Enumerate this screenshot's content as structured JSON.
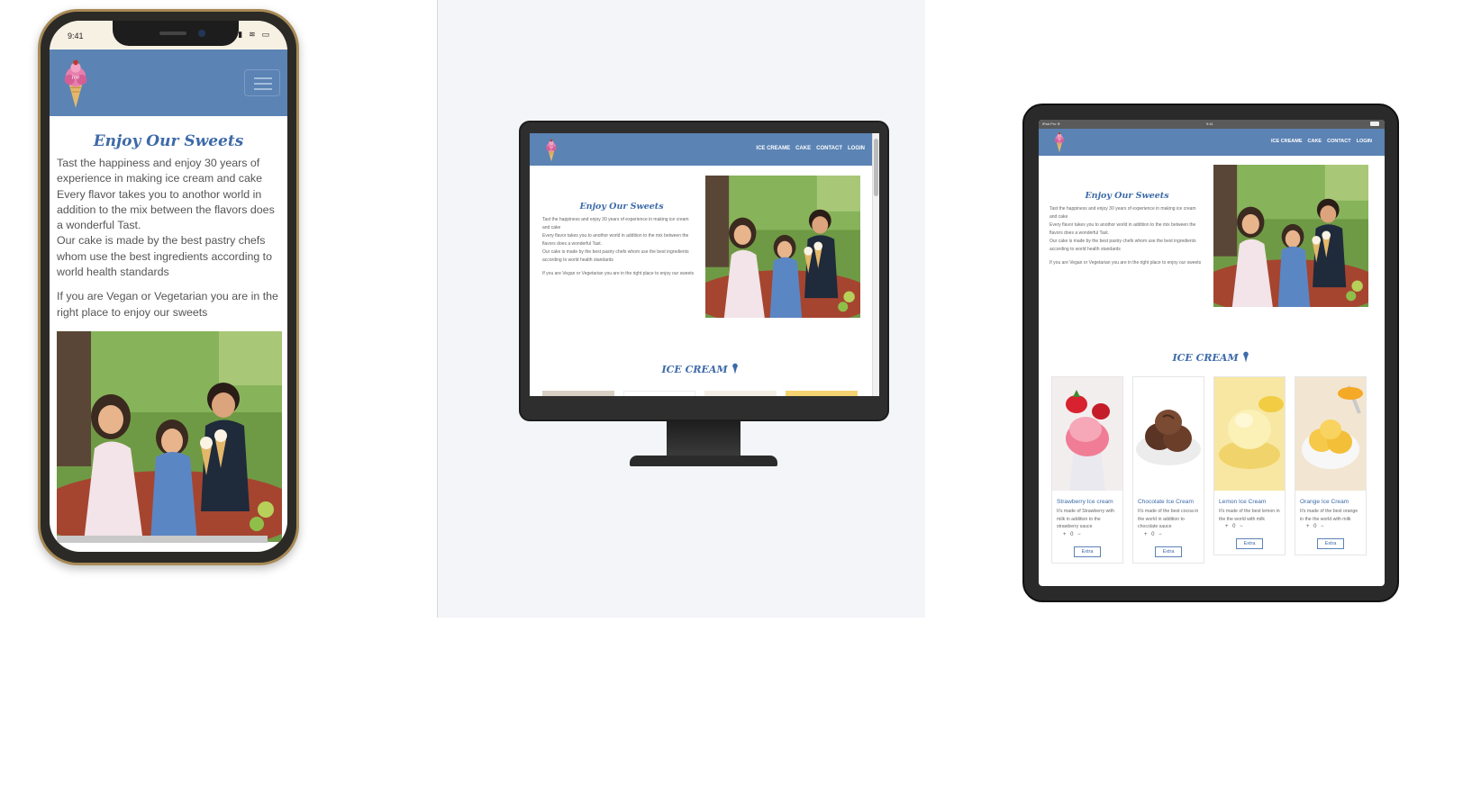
{
  "phone": {
    "status_time": "9:41",
    "status_icons": "▮▮▮ ≋ ▭",
    "title": "Enjoy Our Sweets",
    "paragraph_1": "Tast the happiness and enjoy 30 years of experience in making ice cream and cake Every flavor takes you to anothor world in addition to the mix between the flavors does a wonderful Tast.",
    "paragraph_2": "Our cake is made by the best pastry chefs whom use the best ingredients according to world health standards",
    "paragraph_3": "If you are Vegan or Vegetarian you are in the right place to enjoy our sweets"
  },
  "desktop": {
    "nav": [
      "ICE CREAME",
      "CAKE",
      "CONTACT",
      "LOGIN"
    ],
    "title": "Enjoy Our Sweets",
    "paragraph_1": "Tast the happiness and enjoy 30 years of experience in making ice cream and cake",
    "paragraph_2": "Every flavor takes you to anothor world in addition to the mix between the flavors does a wonderful Tast.",
    "paragraph_3": "Our cake is made by the best pastry chefs whom use the best ingredients according to world health standards",
    "paragraph_4": "If you are Vegan or Vegetarian you are in the right place to enjoy our sweets",
    "section_title": "ICE CREAM"
  },
  "tablet": {
    "status_left": "iPad Pro ≋",
    "status_time": "9:41",
    "nav": [
      "ICE CREAME",
      "CAKE",
      "CONTACT",
      "LOGIN"
    ],
    "title": "Enjoy Our Sweets",
    "paragraph_1": "Tast the happiness and enjoy 30 years of experience in making ice cream and cake",
    "paragraph_2": "Every flavor takes you to anothor world in addition to the mix between the flavors does a wonderful Tast.",
    "paragraph_3": "Our cake is made by the best pastry chefs whom use the best ingredients according to world health standards",
    "paragraph_4": "If you are Vegan or Vegetarian you are in the right place to enjoy our sweets",
    "section_title": "ICE CREAM",
    "cards": [
      {
        "name": "Strawberry Ice cream",
        "desc": "It's made of Strawberry with milk in addition to the strawberry sauce",
        "qty": "+ 0 −",
        "button": "Extra"
      },
      {
        "name": "Chocolate Ice Cream",
        "desc": "It's made of the best cocoa in the world in addition to chocolate sauce",
        "qty": "+ 0 −",
        "button": "Extra"
      },
      {
        "name": "Lemon Ice Cream",
        "desc": "It's made of the best lemon in the the world with milk",
        "qty": "+ 0 −",
        "button": "Extra"
      },
      {
        "name": "Orange Ice Cream",
        "desc": "It's made of the best orange in the the world with milk",
        "qty": "+ 0 −",
        "button": "Extra"
      }
    ]
  },
  "colors": {
    "nav_blue": "#5b83b4",
    "title_blue": "#3d6aa8",
    "phone_frame": "#a88a55"
  }
}
